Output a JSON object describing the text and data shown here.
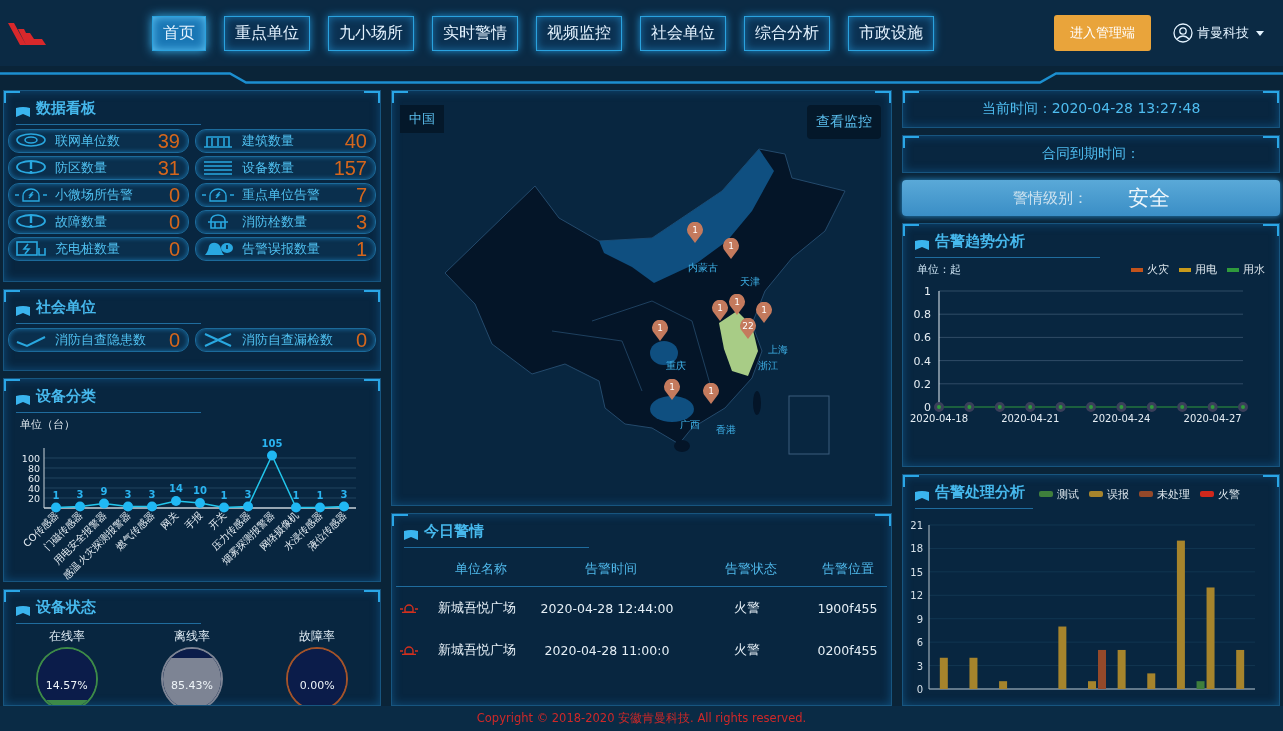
{
  "header": {
    "tabs": [
      {
        "label": "首页",
        "selected": true
      },
      {
        "label": "重点单位",
        "selected": false
      },
      {
        "label": "九小场所",
        "selected": false
      },
      {
        "label": "实时警情",
        "selected": false
      },
      {
        "label": "视频监控",
        "selected": false
      },
      {
        "label": "社会单位",
        "selected": false
      },
      {
        "label": "综合分析",
        "selected": false
      },
      {
        "label": "市政设施",
        "selected": false
      }
    ],
    "admin_button": "进入管理端",
    "user": "肯曼科技"
  },
  "data_board": {
    "title": "数据看板",
    "stats": [
      {
        "label": "联网单位数",
        "value": "39"
      },
      {
        "label": "建筑数量",
        "value": "40"
      },
      {
        "label": "防区数量",
        "value": "31"
      },
      {
        "label": "设备数量",
        "value": "157"
      },
      {
        "label": "小微场所告警",
        "value": "0"
      },
      {
        "label": "重点单位告警",
        "value": "7"
      },
      {
        "label": "故障数量",
        "value": "0"
      },
      {
        "label": "消防栓数量",
        "value": "3"
      },
      {
        "label": "充电桩数量",
        "value": "0"
      },
      {
        "label": "告警误报数量",
        "value": "1"
      }
    ]
  },
  "social_units": {
    "title": "社会单位",
    "stats": [
      {
        "label": "消防自查隐患数",
        "value": "0"
      },
      {
        "label": "消防自查漏检数",
        "value": "0"
      }
    ]
  },
  "device_types": {
    "title": "设备分类",
    "chart_data": {
      "type": "line",
      "ylabel": "单位（台）",
      "categories": [
        "CO传感器",
        "门磁传感器",
        "用电安全报警器",
        "感温火灾探测报警器",
        "燃气传感器",
        "网关",
        "手报",
        "开关",
        "压力传感器",
        "烟雾探测报警器",
        "网络摄像机",
        "水浸传感器",
        "液位传感器"
      ],
      "values": [
        1,
        3,
        9,
        3,
        3,
        14,
        10,
        1,
        3,
        105,
        1,
        1,
        3
      ],
      "ylim": [
        0,
        120
      ],
      "yticks": [
        20,
        40,
        60,
        80,
        100
      ],
      "grid": true,
      "marker": true,
      "data_labels": true
    }
  },
  "device_status": {
    "title": "设备状态",
    "gauges": [
      {
        "label": "在线率",
        "level": 0.1457,
        "reading": "14.57%",
        "color": "#3d8a48"
      },
      {
        "label": "离线率",
        "level": 0.8543,
        "reading": "85.43%",
        "color": "#7d8494"
      },
      {
        "label": "故障率",
        "reading": "0.00%",
        "color": "#a4532a"
      }
    ]
  },
  "map": {
    "title": "中国",
    "button": "查看监控",
    "pins": [
      {
        "count": "1"
      },
      {
        "count": "1"
      },
      {
        "count": "1"
      },
      {
        "count": "1"
      },
      {
        "count": "1"
      },
      {
        "count": "22"
      },
      {
        "count": "1"
      },
      {
        "count": "1"
      },
      {
        "count": "1"
      }
    ],
    "region_labels": [
      "内蒙古",
      "天津",
      "重庆",
      "上海",
      "浙江",
      "广西",
      "香港"
    ]
  },
  "today_alarms": {
    "title": "今日警情",
    "columns": [
      "单位名称",
      "告警时间",
      "告警状态",
      "告警位置"
    ],
    "rows": [
      {
        "unit": "新城吾悦广场",
        "time": "2020-04-28 12:44:00",
        "status": "火警",
        "location": "1900f455"
      },
      {
        "unit": "新城吾悦广场",
        "time": "2020-04-28 11:00:0",
        "status": "火警",
        "location": "0200f455"
      }
    ]
  },
  "current_time": "当前时间：2020-04-28 13:27:48",
  "contract_expiry": "合同到期时间：",
  "alert_level": {
    "label": "警情级别：",
    "value": "安全"
  },
  "alarm_trend": {
    "title": "告警趋势分析",
    "chart_data": {
      "type": "line",
      "ylabel": "单位：起",
      "categories": [
        "2020-04-18",
        null,
        null,
        "2020-04-21",
        null,
        null,
        "2020-04-24",
        null,
        null,
        "2020-04-27",
        null
      ],
      "series": [
        {
          "name": "火灾",
          "color": "#c2531c",
          "values": [
            null,
            null,
            null,
            null,
            null,
            null,
            null,
            null,
            null,
            null,
            null
          ]
        },
        {
          "name": "用电",
          "color": "#c99a1a",
          "values": [
            null,
            null,
            null,
            null,
            null,
            null,
            null,
            null,
            null,
            null,
            null
          ]
        },
        {
          "name": "用水",
          "color": "#2f9a3c",
          "marker": true,
          "values": [
            0,
            0,
            0,
            0,
            0,
            0,
            0,
            0,
            0,
            0,
            0
          ]
        }
      ],
      "grid": true,
      "ylim": [
        0,
        1
      ],
      "yticks": [
        0,
        0.2,
        0.4,
        0.6,
        0.8,
        1
      ]
    }
  },
  "alarm_handling": {
    "title": "告警处理分析",
    "chart_data": {
      "type": "bar",
      "series": [
        {
          "name": "测试",
          "color": "#3f7f3c",
          "values": [
            0,
            0,
            0,
            0,
            0,
            0,
            0,
            0,
            0,
            1,
            0
          ]
        },
        {
          "name": "误报",
          "color": "#a6842c",
          "values": [
            4,
            4,
            1,
            0,
            8,
            1,
            5,
            2,
            19,
            13,
            5
          ]
        },
        {
          "name": "未处理",
          "color": "#94492a",
          "values": [
            0,
            0,
            0,
            0,
            0,
            5,
            0,
            0,
            0,
            0,
            0
          ]
        },
        {
          "name": "火警",
          "color": "#d0281c",
          "values": [
            0,
            0,
            0,
            0,
            0,
            0,
            0,
            0,
            0,
            0,
            0
          ]
        }
      ],
      "grid": true,
      "ylim": [
        0,
        21
      ],
      "yticks": [
        0,
        3,
        6,
        9,
        12,
        15,
        18,
        21
      ]
    }
  },
  "footer": "Copyright © 2018-2020 安徽肯曼科技. All rights reserved."
}
